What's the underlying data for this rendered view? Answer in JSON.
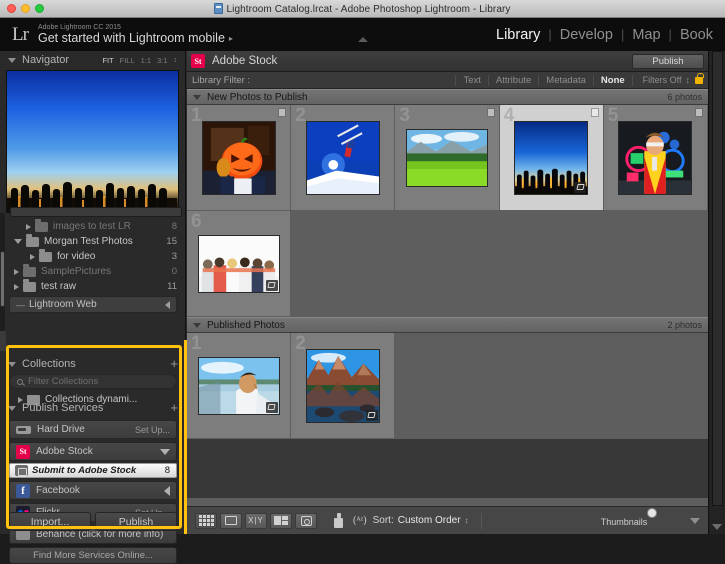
{
  "window": {
    "title": "Lightroom Catalog.lrcat - Adobe Photoshop Lightroom - Library",
    "doc_icon": "document-icon"
  },
  "topbar": {
    "logo": "Lr",
    "identity_small": "Adobe Lightroom CC 2015",
    "identity_big": "Get started with Lightroom mobile",
    "identity_caret": "▸",
    "modules": [
      {
        "label": "Library",
        "active": true
      },
      {
        "label": "Develop",
        "active": false
      },
      {
        "label": "Map",
        "active": false
      },
      {
        "label": "Book",
        "active": false
      }
    ],
    "separator": "|"
  },
  "navigator": {
    "title": "Navigator",
    "zoom_options": [
      "FIT",
      "FILL",
      "1:1",
      "3:1"
    ],
    "selected_zoom": "FIT",
    "stepper": "↕"
  },
  "folders": [
    {
      "label": "images to test LR",
      "count": "8",
      "expandable": true,
      "expanded": false,
      "dim": true,
      "indent": 1
    },
    {
      "label": "Morgan Test Photos",
      "count": "15",
      "expandable": true,
      "expanded": true,
      "dim": false,
      "indent": 0
    },
    {
      "label": "for video",
      "count": "3",
      "expandable": true,
      "expanded": false,
      "dim": false,
      "indent": 1
    },
    {
      "label": "SamplePictures",
      "count": "0",
      "expandable": true,
      "expanded": false,
      "dim": true,
      "indent": 0
    },
    {
      "label": "test raw",
      "count": "11",
      "expandable": true,
      "expanded": false,
      "dim": false,
      "indent": 0
    }
  ],
  "lightroom_web": {
    "label": "Lightroom Web",
    "icon": "sync-icon"
  },
  "collections": {
    "title": "Collections",
    "filter_placeholder": "Filter Collections",
    "items": [
      {
        "label": "Collections dynami...",
        "expandable": true
      }
    ]
  },
  "publish_services": {
    "title": "Publish Services",
    "add_label": "+",
    "items": [
      {
        "name": "Hard Drive",
        "icon": "hard-drive-icon",
        "right_label": "Set Up...",
        "right_type": "text"
      },
      {
        "name": "Adobe Stock",
        "icon": "adobe-stock-icon",
        "icon_text": "St",
        "right_type": "caret-down"
      },
      {
        "name": "Facebook",
        "icon": "facebook-icon",
        "icon_text": "f",
        "right_type": "caret-left"
      },
      {
        "name": "Flickr",
        "icon": "flickr-icon",
        "right_label": "Set Up...",
        "right_type": "text"
      },
      {
        "name": "Behance (click for more info)",
        "icon": "behance-folder-icon",
        "right_type": "none"
      }
    ],
    "sub_item": {
      "label": "Submit to Adobe Stock",
      "count": "8",
      "icon": "publish-collection-icon"
    },
    "find_more": "Find More Services Online..."
  },
  "left_buttons": {
    "import": "Import...",
    "publish": "Publish"
  },
  "stock_header": {
    "logo_text": "St",
    "name": "Adobe Stock",
    "publish_button": "Publish"
  },
  "library_filter": {
    "label": "Library Filter :",
    "options": [
      "Text",
      "Attribute",
      "Metadata",
      "None"
    ],
    "selected": "None",
    "status": "Filters Off",
    "status_stepper": "↕",
    "lock_icon": "lock-icon"
  },
  "sections": [
    {
      "title": "New Photos to Publish",
      "count": "6 photos",
      "cells": [
        {
          "index": "1",
          "image": "jack-o-lantern-portrait",
          "selected": false,
          "badge": false,
          "shape": "square"
        },
        {
          "index": "2",
          "image": "skier-jump-blue-sky",
          "selected": false,
          "badge": false,
          "shape": "square"
        },
        {
          "index": "3",
          "image": "green-field-mountains",
          "selected": false,
          "badge": false,
          "shape": "square"
        },
        {
          "index": "4",
          "image": "crowd-silhouette-sunset",
          "selected": true,
          "badge": true,
          "shape": "square"
        },
        {
          "index": "5",
          "image": "performer-neon-lights",
          "selected": false,
          "badge": false,
          "shape": "square"
        },
        {
          "index": "6",
          "image": "friends-arms-linked",
          "selected": false,
          "badge": true,
          "shape": "wide"
        }
      ]
    },
    {
      "title": "Published Photos",
      "count": "2 photos",
      "cells": [
        {
          "index": "1",
          "image": "man-on-boat-lake",
          "selected": false,
          "badge": true,
          "shape": "wide"
        },
        {
          "index": "2",
          "image": "mountain-lake-reflection",
          "selected": false,
          "badge": true,
          "shape": "square"
        }
      ]
    }
  ],
  "toolbar": {
    "view_icons": [
      "grid-view-icon",
      "loupe-view-icon",
      "compare-view-icon",
      "survey-view-icon",
      "people-view-icon"
    ],
    "spray_icon": "spray-can-icon",
    "sort_icon": "a-z-sort-icon",
    "sort_label": "Sort:",
    "sort_value": "Custom Order",
    "sort_stepper": "↕",
    "thumbnails_label": "Thumbnails",
    "collapse_icon": "chevron-down-icon"
  },
  "colors": {
    "highlight": "#ffc20e",
    "adobe_stock_red": "#e5004a",
    "facebook_blue": "#3b5998",
    "panel_bg": "#2a2a2a",
    "grid_bg": "#5e5e5e"
  }
}
